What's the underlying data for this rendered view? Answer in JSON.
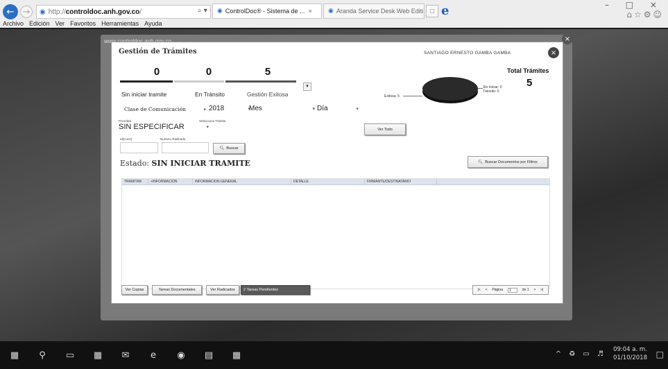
{
  "browser": {
    "address": {
      "scheme": "http://",
      "domain": "controldoc.anh.gov.co",
      "path": "/"
    },
    "tabs": [
      {
        "label": "ControlDoc® - Sistema de ...",
        "active": true
      },
      {
        "label": "Aranda Service Desk Web Editi...",
        "active": false
      }
    ],
    "menu": [
      "Archivo",
      "Edición",
      "Ver",
      "Favoritos",
      "Herramientas",
      "Ayuda"
    ],
    "overlay_url": "www.controldoc.anh.gov.co"
  },
  "modal": {
    "title": "Gestión de Trámites",
    "user": "SANTIAGO ERNESTO GAMBA GAMBA",
    "counters": [
      {
        "value": "0",
        "label": "Sin iniciar tramite"
      },
      {
        "value": "0",
        "label": "En Tránsito"
      },
      {
        "value": "5",
        "label": "Gestión Exitosa"
      }
    ],
    "pie": {
      "left_label": "Exitosa: 5",
      "right_labels": [
        "Sin Iniciar: 0",
        "Tránsito: 0"
      ]
    },
    "total": {
      "label": "Total Trámites",
      "value": "5"
    },
    "filters": {
      "clase": "Clase de Comunicación",
      "year": "2018",
      "mes": "Mes",
      "dia": "Día",
      "prioridad_label": "Prioridad",
      "selecciona_label": "Selecciona Trámite",
      "prioridad_value": "SIN ESPECIFICAR",
      "id_label": "Id(Cons)",
      "numero_label": "Numero Radicado"
    },
    "buttons": {
      "buscar": "Buscar",
      "ver_todo": "Ver Todo",
      "buscar_filtros": "Buscar Documentos por Filtros"
    },
    "estado": {
      "prefix": "Estado:",
      "value": "SIN INICIAR TRAMITE"
    },
    "table": {
      "columns": [
        "TRAMITAR",
        "+INFORMACIÓN",
        "INFORMACION GENERAL",
        "DETALLE",
        "FIRMANTE/DESTINATARIO",
        ""
      ]
    },
    "footer": {
      "ver_copias": "Ver Copias",
      "tareas_documentales": "Tareas Documentales",
      "ver_radicados": "Ver Radicados",
      "tareas_pendientes": "2 Tareas Pendientes",
      "pager": {
        "pagina_label": "Página",
        "page": "1",
        "of_label": "de 1"
      }
    }
  },
  "taskbar": {
    "time": "09:04 a. m.",
    "date": "01/10/2018"
  }
}
